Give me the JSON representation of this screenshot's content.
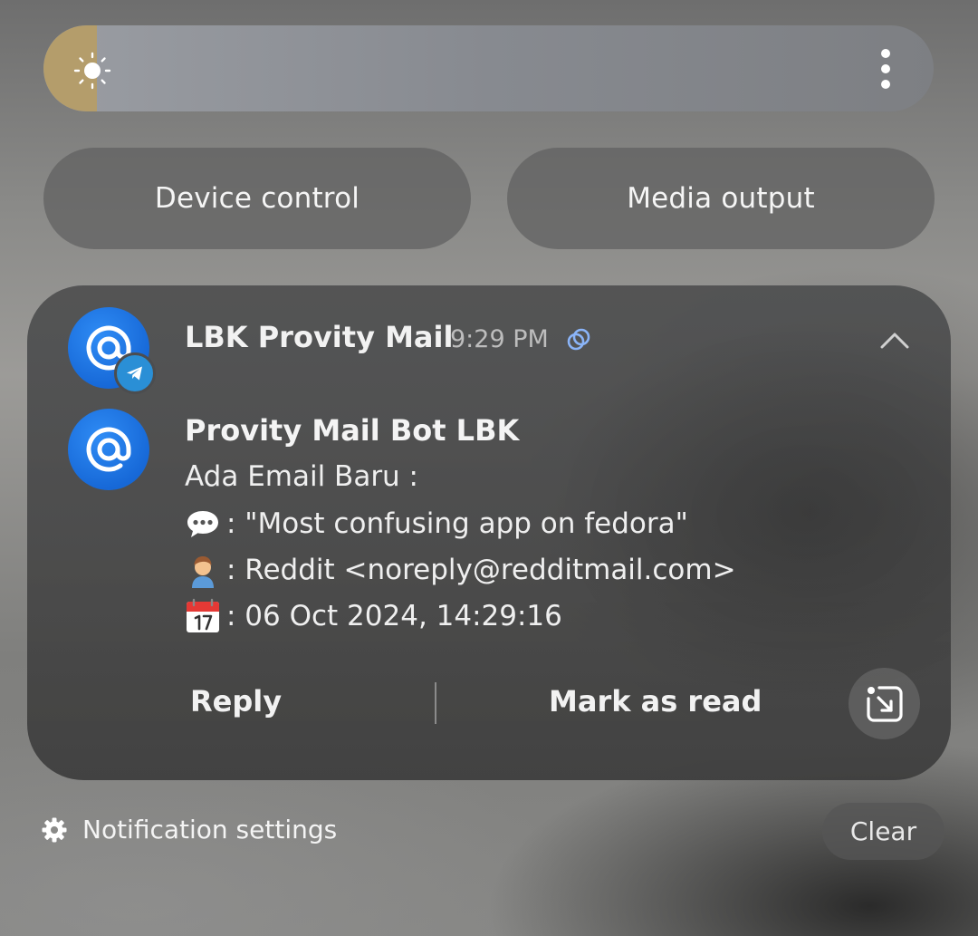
{
  "brightness": {
    "level": 0.06,
    "fill_color": "#b49d6b",
    "icon": "sun-icon",
    "menu_icon": "more-vertical-icon"
  },
  "quick_buttons": {
    "device_control": "Device control",
    "media_output": "Media output"
  },
  "notification": {
    "app_name": "LBK Provity Mail",
    "time": "9:29 PM",
    "app_icon": "at-sign-icon",
    "badge_icon": "telegram-icon",
    "badge_color": "#2a8fd6",
    "sender": "Provity Mail Bot LBK",
    "lines": [
      {
        "emoji": "speech-bubble-icon",
        "text": "Ada Email Baru :"
      },
      {
        "emoji": "speech-bubble-icon",
        "text": ": \"Most confusing app on fedora\""
      },
      {
        "emoji": "person-icon",
        "text": ": Reddit <noreply@redditmail.com>"
      },
      {
        "emoji": "calendar-icon",
        "text": ": 06 Oct 2024, 14:29:16"
      }
    ],
    "actions": {
      "reply": "Reply",
      "mark_as_read": "Mark as read"
    },
    "accent_color": "#1769d8"
  },
  "footer": {
    "notification_settings": "Notification settings",
    "clear": "Clear"
  }
}
